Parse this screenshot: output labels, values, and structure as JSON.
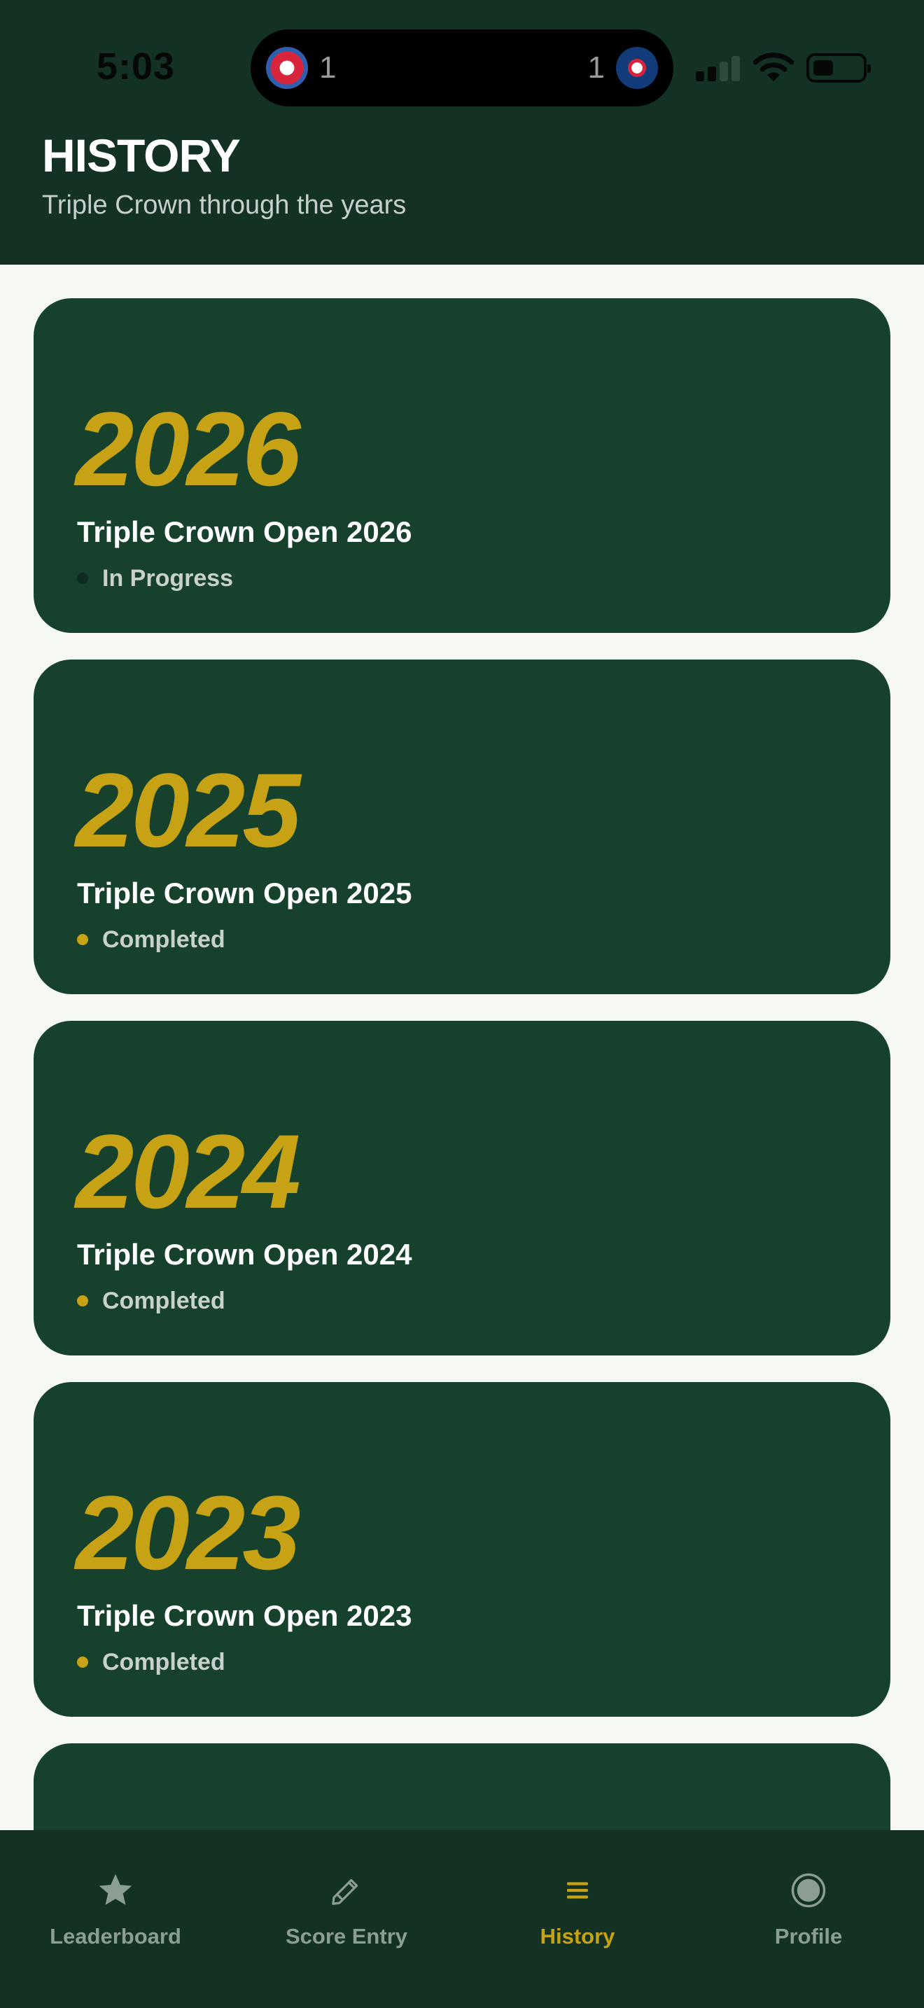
{
  "status_bar": {
    "time": "5:03",
    "live_score": {
      "home": "1",
      "away": "1"
    }
  },
  "header": {
    "title": "HISTORY",
    "subtitle": "Triple Crown through the years"
  },
  "tournaments": [
    {
      "year": "2026",
      "name": "Triple Crown Open 2026",
      "status": "In Progress",
      "status_color": "#0f2a1e"
    },
    {
      "year": "2025",
      "name": "Triple Crown Open 2025",
      "status": "Completed",
      "status_color": "#c6a214"
    },
    {
      "year": "2024",
      "name": "Triple Crown Open 2024",
      "status": "Completed",
      "status_color": "#c6a214"
    },
    {
      "year": "2023",
      "name": "Triple Crown Open 2023",
      "status": "Completed",
      "status_color": "#c6a214"
    },
    {
      "year": "",
      "name": "",
      "status": "",
      "status_color": "#16412d"
    }
  ],
  "tab_bar": {
    "tabs": [
      {
        "label": "Leaderboard",
        "icon": "star-icon",
        "active": false
      },
      {
        "label": "Score Entry",
        "icon": "pencil-icon",
        "active": false
      },
      {
        "label": "History",
        "icon": "list-icon",
        "active": true
      },
      {
        "label": "Profile",
        "icon": "profile-icon",
        "active": false
      }
    ]
  },
  "colors": {
    "header_bg": "#133224",
    "card_bg": "#16412d",
    "accent_gold": "#c6a214",
    "page_bg": "#f6f8f2",
    "tab_inactive": "#8c9d94"
  }
}
